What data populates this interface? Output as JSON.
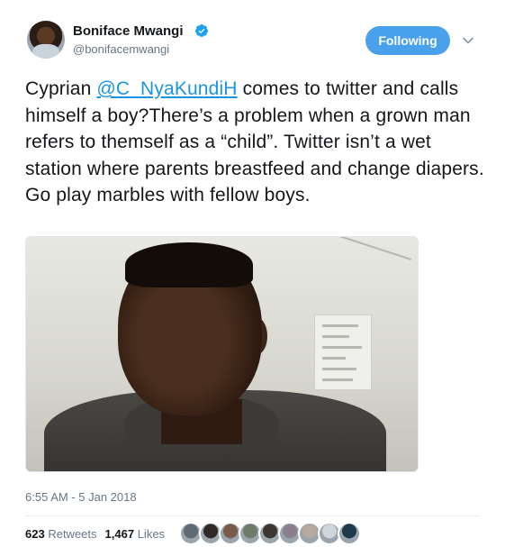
{
  "author": {
    "name": "Boniface Mwangi",
    "handle": "@bonifacemwangi",
    "verified": true
  },
  "follow_button": {
    "label": "Following"
  },
  "tweet": {
    "text_before": "Cyprian ",
    "mention": "@C_NyaKundiH",
    "text_after": " comes to twitter and calls himself a boy?There’s a problem when a grown man refers to themself as a “child”. Twitter isn’t a wet station where parents breastfeed and change diapers. Go play marbles with fellow boys."
  },
  "timestamp": "6:55 AM - 5 Jan 2018",
  "stats": {
    "retweets_count": "623",
    "retweets_label": "Retweets",
    "likes_count": "1,467",
    "likes_label": "Likes"
  },
  "liker_avatars": [
    "#5d6a74",
    "#2f2a28",
    "#7a5a48",
    "#6e7b6a",
    "#3c3530",
    "#8a7f8c",
    "#b7a9a0",
    "#cfd6db",
    "#1e3a4a"
  ],
  "colors": {
    "accent": "#1b95e0",
    "follow_bg": "#4aa1eb",
    "verified": "#1da1f2",
    "muted": "#657786"
  },
  "icons": {
    "verified": "verified-badge-icon",
    "menu": "chevron-down-icon"
  }
}
